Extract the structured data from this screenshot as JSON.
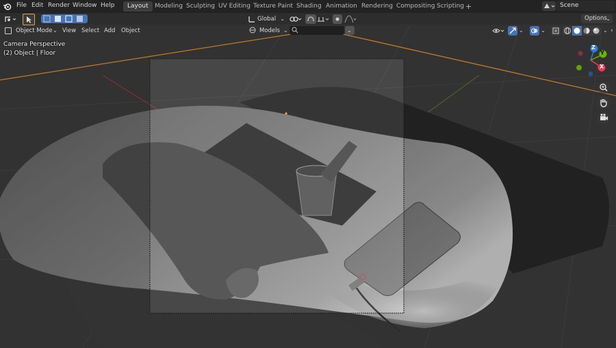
{
  "menu": {
    "items": [
      "File",
      "Edit",
      "Render",
      "Window",
      "Help"
    ]
  },
  "workspaces": {
    "tabs": [
      "Layout",
      "Modeling",
      "Sculpting",
      "UV Editing",
      "Texture Paint",
      "Shading",
      "Animation",
      "Rendering",
      "Compositing",
      "Scripting"
    ],
    "active": "Layout",
    "add_label": "+"
  },
  "scene": {
    "name": "Scene"
  },
  "header": {
    "transform_orientation": "Global",
    "options_label": "Options"
  },
  "view_header": {
    "mode": "Object Mode",
    "menus": [
      "View",
      "Select",
      "Add",
      "Object"
    ],
    "collection": "Models",
    "search_placeholder": ""
  },
  "viewport": {
    "camera_label": "Camera Perspective",
    "object_label": "(2) Object | Floor"
  },
  "gizmo": {
    "axes": [
      "Z",
      "Y",
      "X"
    ]
  },
  "colors": {
    "accent_blue": "#4772b3",
    "active_tab": "#3d3d3d",
    "x_axis": "#ee3b54",
    "y_axis": "#6ab400",
    "z_axis": "#2e7dd7",
    "selection_orange": "#f39a3a"
  },
  "icons": [
    "blender-logo-icon",
    "cursor-tool-icon",
    "select-box-icon",
    "global-orientation-icon",
    "link-icon",
    "snap-icon",
    "proportional-icon",
    "falloff-icon",
    "visibility-icon",
    "gizmo-icon",
    "overlay-icon",
    "xray-icon",
    "wireframe-shading-icon",
    "solid-shading-icon",
    "material-shading-icon",
    "rendered-shading-icon",
    "zoom-icon",
    "hand-pan-icon",
    "camera-icon",
    "search-icon",
    "collection-icon"
  ]
}
